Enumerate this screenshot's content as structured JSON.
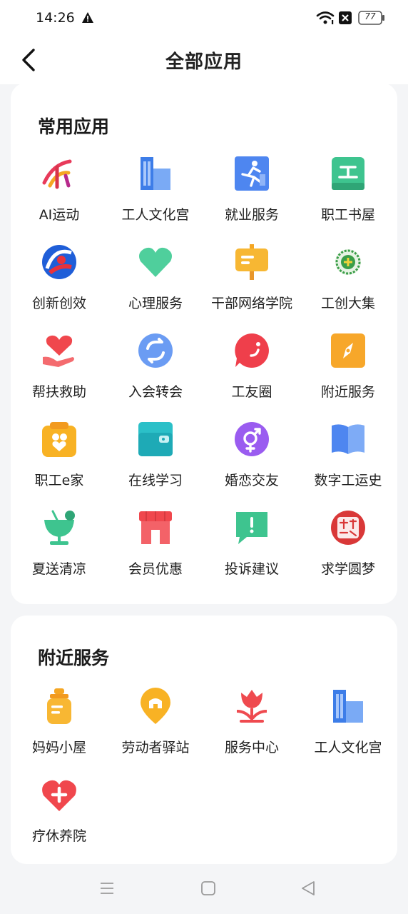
{
  "status": {
    "time": "14:26",
    "battery": "77"
  },
  "header": {
    "title": "全部应用"
  },
  "common": {
    "title": "常用应用",
    "apps": [
      {
        "label": "AI运动",
        "icon": "ai-sport-icon"
      },
      {
        "label": "工人文化宫",
        "icon": "culture-palace-icon"
      },
      {
        "label": "就业服务",
        "icon": "employment-icon"
      },
      {
        "label": "职工书屋",
        "icon": "book-house-icon"
      },
      {
        "label": "创新创效",
        "icon": "innovation-icon"
      },
      {
        "label": "心理服务",
        "icon": "heart-icon"
      },
      {
        "label": "干部网络学院",
        "icon": "signboard-icon"
      },
      {
        "label": "工创大集",
        "icon": "market-seal-icon"
      },
      {
        "label": "帮扶救助",
        "icon": "hand-heart-icon"
      },
      {
        "label": "入会转会",
        "icon": "transfer-icon"
      },
      {
        "label": "工友圈",
        "icon": "chat-bubble-icon"
      },
      {
        "label": "附近服务",
        "icon": "compass-icon"
      },
      {
        "label": "职工e家",
        "icon": "family-icon"
      },
      {
        "label": "在线学习",
        "icon": "wallet-icon"
      },
      {
        "label": "婚恋交友",
        "icon": "gender-icon"
      },
      {
        "label": "数字工运史",
        "icon": "open-book-icon"
      },
      {
        "label": "夏送清凉",
        "icon": "cold-drink-icon"
      },
      {
        "label": "会员优惠",
        "icon": "shop-icon"
      },
      {
        "label": "投诉建议",
        "icon": "complaint-icon"
      },
      {
        "label": "求学圆梦",
        "icon": "study-dream-icon"
      }
    ]
  },
  "nearby": {
    "title": "附近服务",
    "apps": [
      {
        "label": "妈妈小屋",
        "icon": "baby-bottle-icon"
      },
      {
        "label": "劳动者驿站",
        "icon": "location-pin-icon"
      },
      {
        "label": "服务中心",
        "icon": "flower-icon"
      },
      {
        "label": "工人文化宫",
        "icon": "culture-palace-icon"
      },
      {
        "label": "疗休养院",
        "icon": "medical-heart-icon"
      }
    ]
  },
  "colors": {
    "blue": "#4e86f0",
    "green": "#3ec48f",
    "orange": "#f5a623",
    "red": "#f0474d",
    "purple": "#8a5cf0",
    "teal": "#2bc0c8"
  }
}
